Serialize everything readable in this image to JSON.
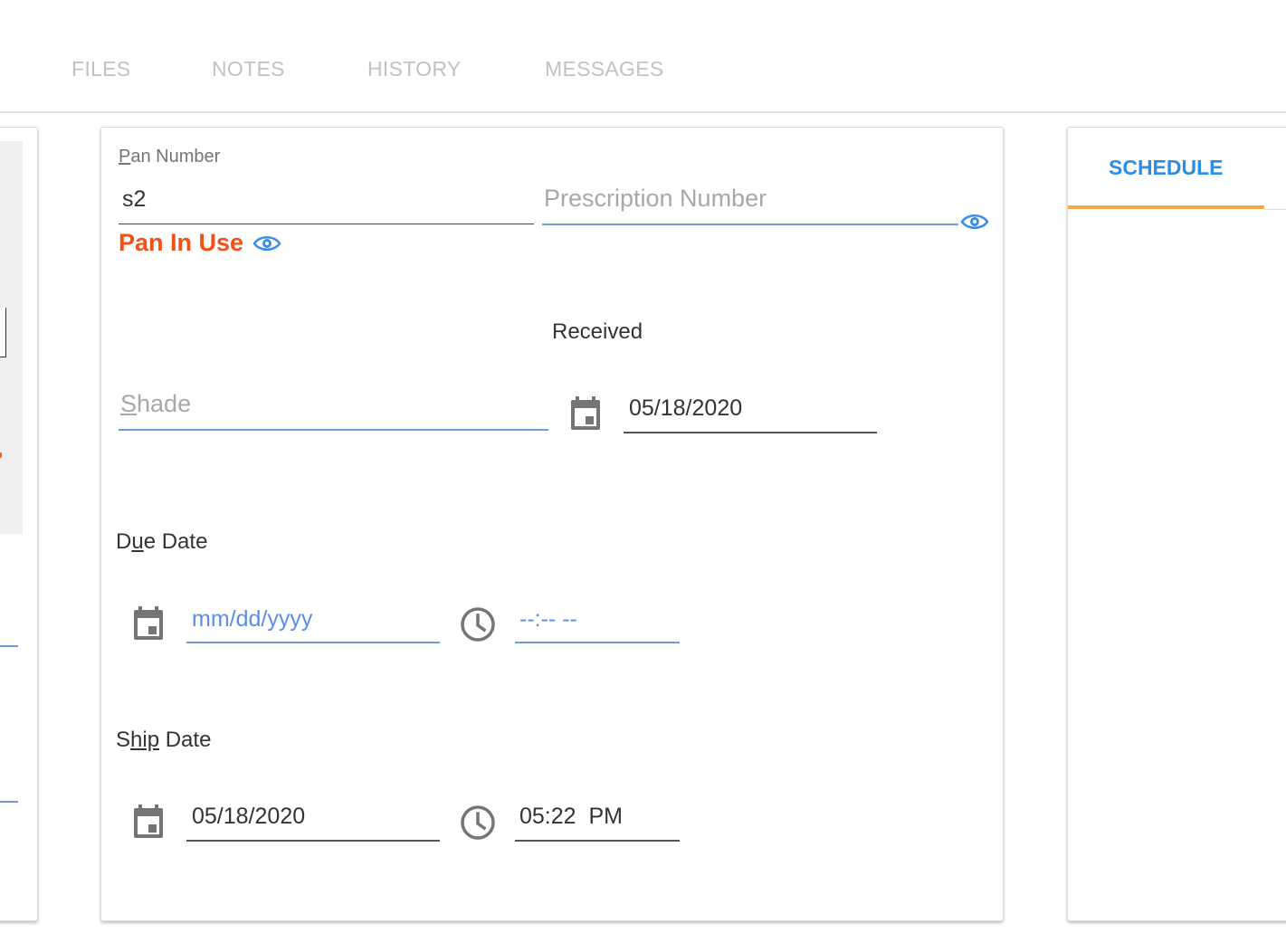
{
  "tabs": [
    {
      "label": "FILES"
    },
    {
      "label": "NOTES"
    },
    {
      "label": "HISTORY"
    },
    {
      "label": "MESSAGES"
    }
  ],
  "form": {
    "pan_number": {
      "label_first": "P",
      "label_rest": "an Number",
      "value": "s2"
    },
    "pan_error": "Pan In Use",
    "prescription": {
      "placeholder": "Prescription Number"
    },
    "received": {
      "label": "Received",
      "date": "05/18/2020"
    },
    "shade": {
      "placeholder_first": "S",
      "placeholder_rest": "hade"
    },
    "due_date": {
      "label_pre": "D",
      "label_u": "u",
      "label_post": "e Date",
      "date_placeholder": "mm/dd/yyyy",
      "time_placeholder": "--:-- --"
    },
    "ship_date": {
      "label_pre": "S",
      "label_u": "hip",
      "label_post": " Date",
      "date": "05/18/2020",
      "time": "05:22  PM"
    }
  },
  "schedule_panel": {
    "tab": "SCHEDULE"
  },
  "colors": {
    "accent_blue": "#2a8de6",
    "error_orange": "#f25116",
    "tab_indicator": "#f5a84a",
    "field_blue": "#6f9ae0"
  },
  "icons": [
    "eye-icon",
    "calendar-icon",
    "clock-icon"
  ]
}
